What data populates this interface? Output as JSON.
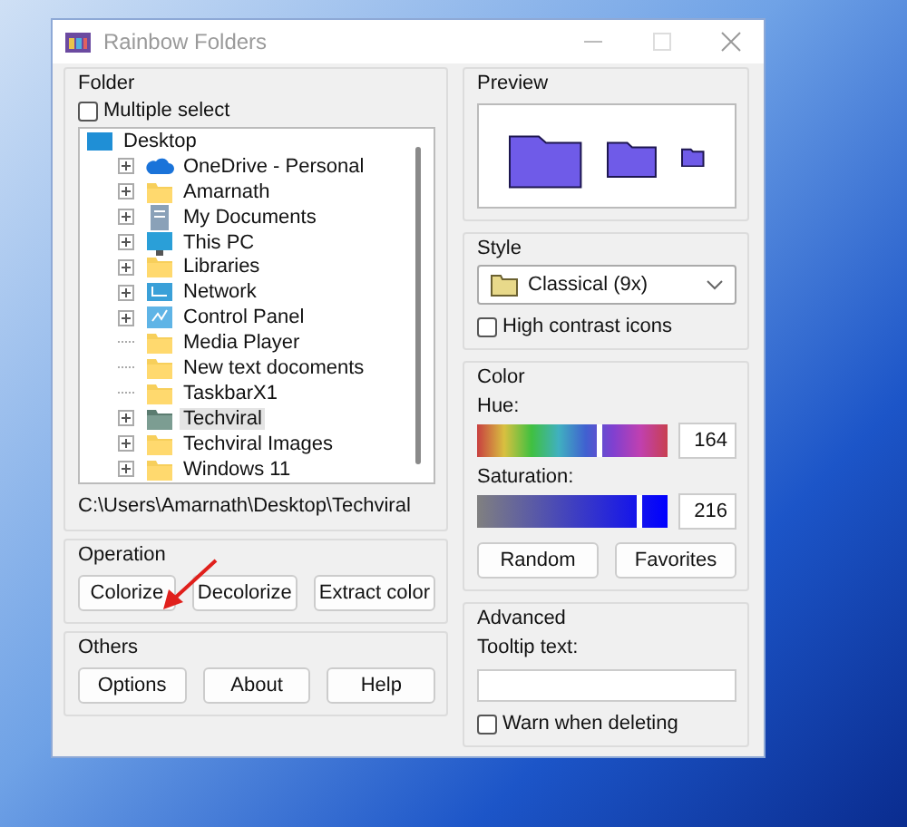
{
  "window": {
    "title": "Rainbow Folders"
  },
  "folder": {
    "title": "Folder",
    "multiple_select": {
      "label": "Multiple select",
      "checked": false
    },
    "tree": [
      {
        "label": "Desktop",
        "kind": "desktop",
        "selected": false,
        "children": [
          {
            "label": "OneDrive - Personal",
            "kind": "cloud",
            "expandable": true,
            "selected": false
          },
          {
            "label": "Amarnath",
            "kind": "folder",
            "expandable": true,
            "selected": false
          },
          {
            "label": "My Documents",
            "kind": "documents",
            "expandable": true,
            "selected": false
          },
          {
            "label": "This PC",
            "kind": "pc",
            "expandable": true,
            "selected": false
          },
          {
            "label": "Libraries",
            "kind": "folder",
            "expandable": true,
            "selected": false
          },
          {
            "label": "Network",
            "kind": "network",
            "expandable": true,
            "selected": false
          },
          {
            "label": "Control Panel",
            "kind": "control-panel",
            "expandable": true,
            "selected": false
          },
          {
            "label": "Media Player",
            "kind": "folder",
            "expandable": false,
            "selected": false
          },
          {
            "label": "New text docoments",
            "kind": "folder",
            "expandable": false,
            "selected": false
          },
          {
            "label": "TaskbarX1",
            "kind": "folder",
            "expandable": false,
            "selected": false
          },
          {
            "label": "Techviral",
            "kind": "tinted-folder",
            "expandable": true,
            "selected": true
          },
          {
            "label": "Techviral Images",
            "kind": "folder",
            "expandable": true,
            "selected": false
          },
          {
            "label": "Windows 11",
            "kind": "folder",
            "expandable": true,
            "selected": false
          }
        ]
      }
    ],
    "path": "C:\\Users\\Amarnath\\Desktop\\Techviral"
  },
  "operation": {
    "title": "Operation",
    "buttons": [
      "Colorize",
      "Decolorize",
      "Extract color"
    ]
  },
  "others": {
    "title": "Others",
    "buttons": [
      "Options",
      "About",
      "Help"
    ]
  },
  "preview": {
    "title": "Preview"
  },
  "style": {
    "title": "Style",
    "value": "Classical (9x)",
    "high_contrast": {
      "label": "High contrast icons",
      "checked": false
    }
  },
  "color": {
    "title": "Color",
    "hue": {
      "label": "Hue:",
      "level": 0.64,
      "reading": "164"
    },
    "saturation": {
      "label": "Saturation:",
      "level": 0.85,
      "reading": "216"
    },
    "buttons": [
      "Random",
      "Favorites"
    ]
  },
  "advanced": {
    "title": "Advanced",
    "tooltip_label": "Tooltip text:",
    "warn": {
      "label": "Warn when deleting",
      "checked": false
    }
  }
}
